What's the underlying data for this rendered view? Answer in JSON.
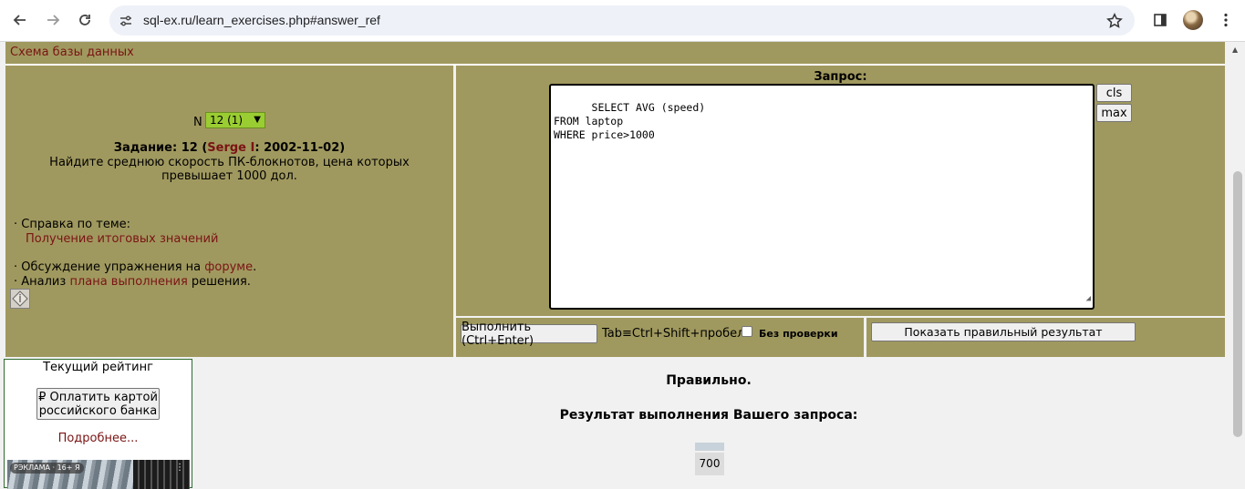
{
  "browser": {
    "url": "sql-ex.ru/learn_exercises.php#answer_ref",
    "icons": [
      "back-arrow-icon",
      "forward-arrow-icon",
      "reload-icon",
      "site-settings-icon",
      "bookmark-star-icon",
      "side-panel-icon",
      "profile-avatar",
      "more-menu-icon"
    ]
  },
  "header": {
    "schema_link": "Схема базы данных"
  },
  "exercise": {
    "n_label": "N",
    "n_selected": "12 (1)",
    "task_prefix": "Задание: 12 (",
    "author": "Serge I",
    "task_suffix": ": 2002-11-02)",
    "description": "Найдите среднюю скорость ПК-блокнотов, цена которых превышает 1000 дол.",
    "help_prefix": "· Справка по теме:",
    "help_link": "Получение итоговых значений",
    "discussion_prefix": "· Обсуждение упражнения на ",
    "discussion_link": "форуме",
    "discussion_suffix": ".",
    "analysis_prefix": "· Анализ ",
    "analysis_link": "плана выполнения",
    "analysis_suffix": " решения."
  },
  "query": {
    "title": "Запрос:",
    "text": "SELECT AVG (speed)\nFROM laptop\nWHERE price>1000",
    "cls_label": "cls",
    "max_label": "max",
    "run_label": "Выполнить (Ctrl+Enter)",
    "tab_hint": "Tab≡Ctrl+Shift+пробел",
    "no_check_label": "Без проверки",
    "no_check_checked": false,
    "show_result_label": "Показать правильный результат"
  },
  "rating": {
    "title": "Текущий рейтинг",
    "pay_line1": "₽ Оплатить картой",
    "pay_line2": "российского банка",
    "more_link": "Подробнее...",
    "ad_badge": "РЭКЛАМА · 16+ Я"
  },
  "result": {
    "status": "Правильно.",
    "title": "Результат выполнения Вашего запроса:",
    "value": "700"
  }
}
